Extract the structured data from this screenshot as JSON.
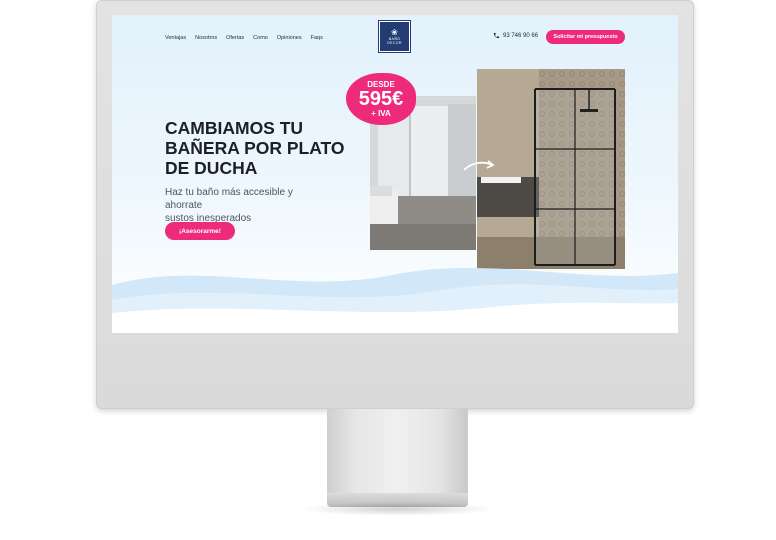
{
  "nav": {
    "items": [
      "Ventajas",
      "Nosotros",
      "Ofertas",
      "Como",
      "Opiniones",
      "Faqs"
    ]
  },
  "logo": {
    "mark": "❀",
    "text_top": "BAÑO",
    "text_bottom": "DECOR"
  },
  "header": {
    "phone": "93 746 90 66",
    "cta": "Solicitar mi presupuesto"
  },
  "hero": {
    "title_lines": [
      "CAMBIAMOS TU",
      "BAÑERA POR PLATO",
      "DE DUCHA"
    ],
    "subtitle_lines": [
      "Haz tu baño más accesible y ahorrate",
      "sustos inesperados"
    ],
    "cta": "¡Asesorarme!"
  },
  "badge": {
    "desde": "DESDE",
    "price": "595€",
    "iva": "+ IVA"
  },
  "colors": {
    "accent": "#ee2a7b",
    "logo_bg": "#233d74",
    "text_dark": "#1c1f26"
  },
  "icons": {
    "phone": "phone-icon",
    "arrow": "arrow-right-icon"
  }
}
